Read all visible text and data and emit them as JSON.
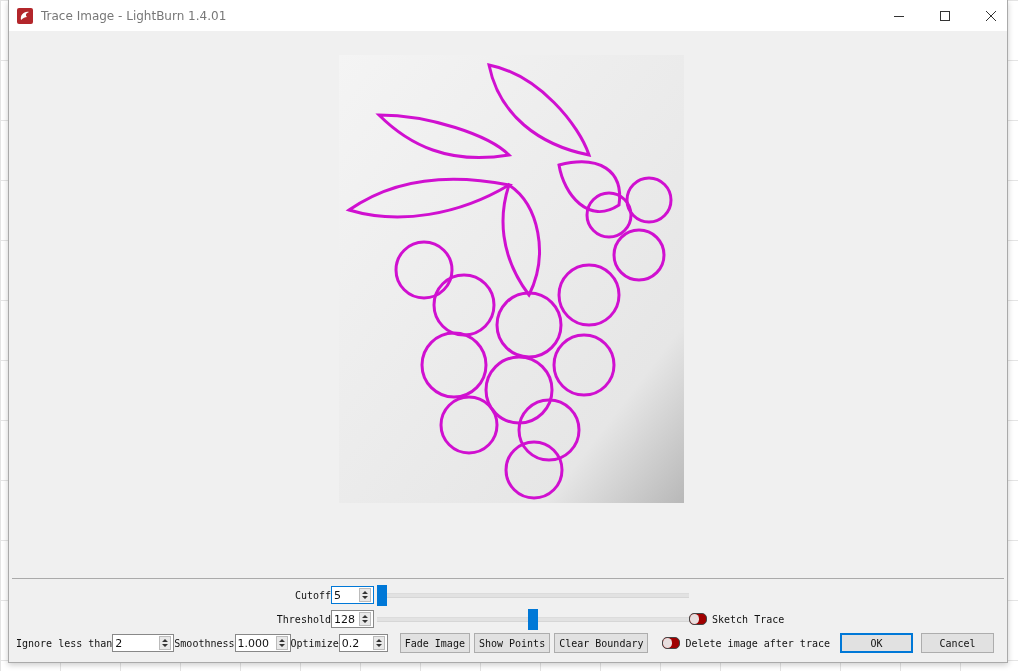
{
  "window": {
    "title": "Trace Image - LightBurn 1.4.01"
  },
  "sliders": [
    {
      "label": "Cutoff",
      "value": "5",
      "focused": true,
      "level": 0.0
    },
    {
      "label": "Threshold",
      "value": "128",
      "focused": false,
      "level": 0.5,
      "toggle": {
        "label": "Sketch Trace",
        "on": false
      }
    }
  ],
  "fields": [
    {
      "label": "Ignore less than",
      "value": "2"
    },
    {
      "label": "Smoothness",
      "value": "1.000"
    },
    {
      "label": "Optimize",
      "value": "0.2"
    }
  ],
  "buttons": [
    "Fade Image",
    "Show Points",
    "Clear Boundary"
  ],
  "delete_toggle": {
    "label": "Delete image after trace",
    "on": false
  },
  "dialog_buttons": [
    {
      "label": "OK",
      "default": true
    },
    {
      "label": "Cancel",
      "default": false
    }
  ]
}
